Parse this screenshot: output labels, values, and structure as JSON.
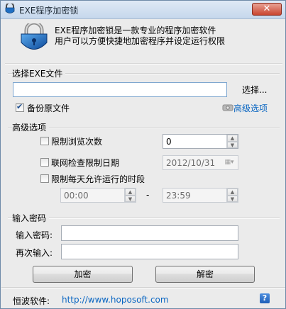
{
  "window": {
    "title": "EXE程序加密锁",
    "close": "✕"
  },
  "banner": {
    "line1": "EXE程序加密锁是一款专业的程序加密软件",
    "line2": "用户可以方便快捷地加密程序并设定运行权限"
  },
  "select_file": {
    "section_label": "选择EXE文件",
    "file_path": "",
    "browse_label": "选择...",
    "backup_checked": true,
    "backup_label": "备份原文件",
    "advanced_link": "高级选项"
  },
  "advanced": {
    "section_label": "高级选项",
    "limit_views_label": "限制浏览次数",
    "limit_views_checked": false,
    "limit_views_value": "0",
    "net_date_label": "联网检查限制日期",
    "net_date_checked": false,
    "net_date_value": "2012/10/31",
    "time_range_label": "限制每天允许运行的时段",
    "time_range_checked": false,
    "time_start": "00:00",
    "time_separator": "-",
    "time_end": "23:59"
  },
  "password": {
    "section_label": "输入密码",
    "password_label": "输入密码:",
    "password_value": "",
    "confirm_label": "再次输入:",
    "confirm_value": "",
    "encrypt_label": "加密",
    "decrypt_label": "解密"
  },
  "footer": {
    "vendor_label": "恒波软件:",
    "url": "http://www.hoposoft.com",
    "help": "?"
  }
}
